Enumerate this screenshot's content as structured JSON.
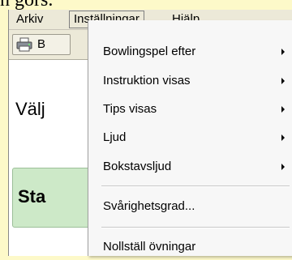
{
  "document": {
    "partial_text": "n görs."
  },
  "menubar": {
    "items": [
      {
        "label": "Arkiv"
      },
      {
        "label": "Inställningar",
        "active": true
      },
      {
        "label": "Hjälp"
      }
    ]
  },
  "toolbar": {
    "print_button_label": "B",
    "icon": "printer-icon"
  },
  "main": {
    "choose_label": "Välj",
    "start_button_label": "Sta"
  },
  "dropdown": {
    "items": [
      {
        "label": "Bowlingspel efter",
        "submenu": true
      },
      {
        "label": "Instruktion visas",
        "submenu": true
      },
      {
        "label": "Tips visas",
        "submenu": true
      },
      {
        "label": "Ljud",
        "submenu": true
      },
      {
        "label": "Bokstavsljud",
        "submenu": true
      },
      {
        "label": "Svårighetsgrad...",
        "submenu": false
      },
      {
        "label": "Nollställ övningar",
        "submenu": false
      }
    ]
  },
  "colors": {
    "page_background": "#fdf9c9",
    "menu_background": "#f7f7f7",
    "start_button": "#cde9c8"
  }
}
